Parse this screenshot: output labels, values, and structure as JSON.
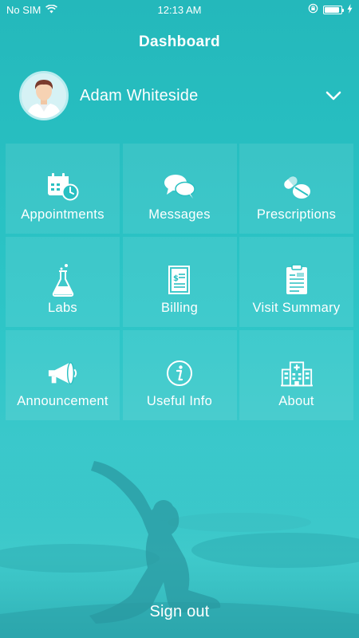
{
  "status": {
    "carrier": "No SIM",
    "time": "12:13 AM",
    "wifi_icon": "wifi-icon",
    "battery_level": 0.9
  },
  "nav": {
    "title": "Dashboard"
  },
  "profile": {
    "name": "Adam Whiteside",
    "avatar_icon": "user-avatar",
    "dropdown_icon": "chevron-down-icon"
  },
  "tiles": [
    {
      "label": "Appointments",
      "icon": "calendar-clock-icon"
    },
    {
      "label": "Messages",
      "icon": "chat-bubbles-icon"
    },
    {
      "label": "Prescriptions",
      "icon": "pills-icon"
    },
    {
      "label": "Labs",
      "icon": "flask-icon"
    },
    {
      "label": "Billing",
      "icon": "bill-icon"
    },
    {
      "label": "Visit Summary",
      "icon": "clipboard-icon"
    },
    {
      "label": "Announcement",
      "icon": "megaphone-icon"
    },
    {
      "label": "Useful Info",
      "icon": "info-icon"
    },
    {
      "label": "About",
      "icon": "hospital-icon"
    }
  ],
  "footer": {
    "sign_out": "Sign out"
  },
  "colors": {
    "background": "#29c2c4",
    "text": "#ffffff"
  }
}
